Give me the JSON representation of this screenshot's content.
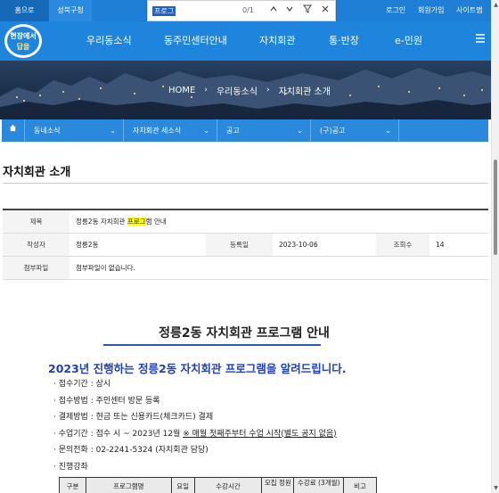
{
  "topbar": {
    "home": "홈으로",
    "gov": "성북구청",
    "login": "로그인",
    "signup": "회원가입",
    "sitemap": "사이트맵"
  },
  "findbar": {
    "query": "프로그",
    "count": "0/1"
  },
  "logo": {
    "line1": "현장에서",
    "line2": "답을"
  },
  "nav": [
    "우리동소식",
    "동주민센터안내",
    "자치회관",
    "통·반장",
    "e-민원"
  ],
  "hero": {
    "home": "HOME",
    "crumb1": "우리동소식",
    "crumb2": "자치회관 소개"
  },
  "subnav": [
    "동네소식",
    "자치회관 세소식",
    "공고",
    "(구)공고"
  ],
  "page_title": "자치회관 소개",
  "info": {
    "subject_label": "제목",
    "subject_pre": "정릉2동 자치회관 ",
    "subject_hl": "프로그",
    "subject_post": "램 안내",
    "author_label": "작성자",
    "author": "정릉2동",
    "date_label": "등록일",
    "date": "2023-10-06",
    "views_label": "조회수",
    "views": "14",
    "attach_label": "첨부파일",
    "attach": "첨부파일이 없습니다."
  },
  "content": {
    "title": "정릉2동 자치회관 프로그램 안내",
    "lead": "2023년 진행하는 정릉2동 자치회관 프로그램을 알려드립니다.",
    "b1": "· 접수기간 : 상시",
    "b2": "· 접수방법 : 주민센터 방문 등록",
    "b3": "· 결제방법 : 현금 또는 신용카드(체크카드) 결제",
    "b4_pre": "· 수업기간 : 접수 시 ~ 2023년 12월  ",
    "b4_u": "※ 매월 첫째주부터 수업 시작(별도 공지 없음)",
    "b5": "· 문의전화 : 02-2241-5324 (자치회관 담당)",
    "b6": "· 진행강좌"
  },
  "table_headers": [
    "구분",
    "프로그램명",
    "요일",
    "수강시간",
    "모집 정원",
    "수강료 (3개월)",
    "비고"
  ],
  "colors": {
    "primary": "#1f84dc",
    "lead_blue": "#1f3fc4",
    "highlight": "#ffff00"
  }
}
